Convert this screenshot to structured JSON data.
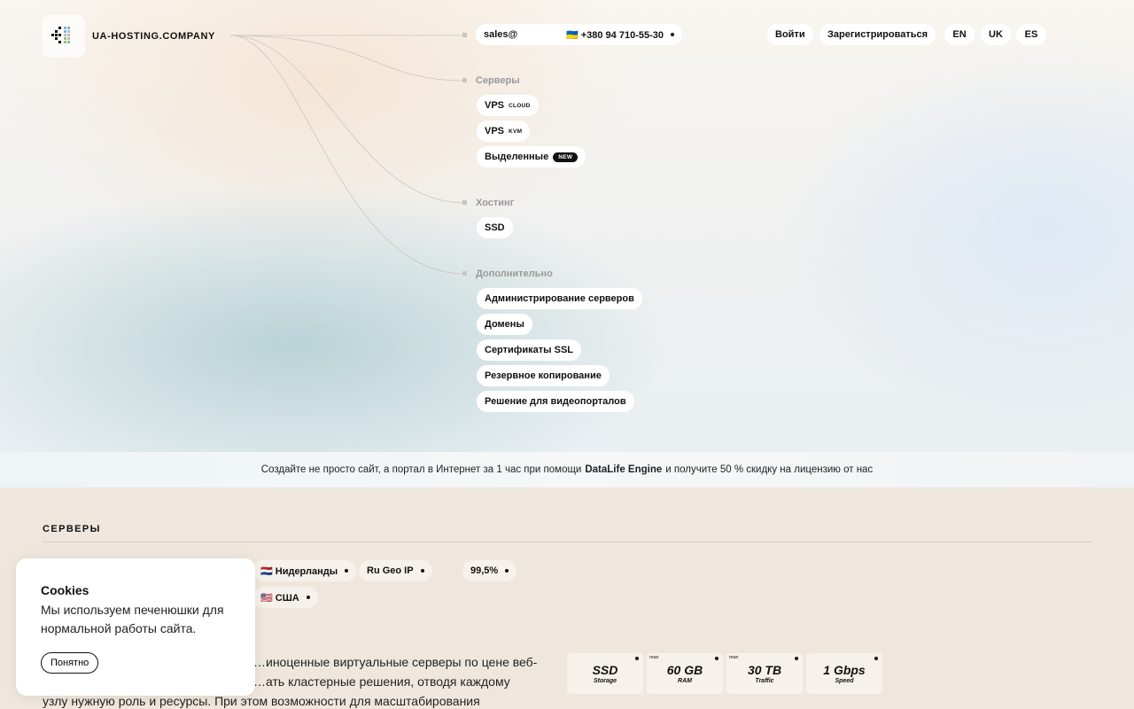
{
  "brand": {
    "name": "UA-HOSTING.COMPANY"
  },
  "contact": {
    "email": "sales@",
    "phone": "🇺🇦 +380 94 710-55-30"
  },
  "auth": {
    "login": "Войти",
    "register": "Зарегистрироваться"
  },
  "languages": [
    "EN",
    "UK",
    "ES"
  ],
  "menu": {
    "servers": {
      "title": "Серверы",
      "items": [
        {
          "label": "VPS",
          "tag": "CLOUD"
        },
        {
          "label": "VPS",
          "tag": "KVM"
        },
        {
          "label": "Выделенные",
          "badge": "NEW"
        }
      ]
    },
    "hosting": {
      "title": "Хостинг",
      "items": [
        {
          "label": "SSD"
        }
      ]
    },
    "extra": {
      "title": "Дополнительно",
      "items": [
        {
          "label": "Администрирование серверов"
        },
        {
          "label": "Домены"
        },
        {
          "label": "Сертификаты SSL"
        },
        {
          "label": "Резервное копирование"
        },
        {
          "label": "Решение для видеопорталов"
        }
      ]
    }
  },
  "promo": {
    "before": "Создайте не просто сайт, а портал в Интернет за 1 час при помощи",
    "highlight": "DataLife Engine",
    "after": "и получите 50 % скидку на лицензию от нас"
  },
  "section": {
    "title": "СЕРВЕРЫ",
    "locations": [
      "🇳🇱 Нидерланды",
      "Ru Geo IP",
      "🇺🇸 США"
    ],
    "uptime": "99,5%",
    "description_lines": [
      "…иноценные виртуальные серверы по цене веб-",
      "…ать кластерные решения, отводя каждому",
      "узлу нужную роль и ресурсы. При этом возможности для масштабирования"
    ],
    "specs": [
      {
        "value": "SSD",
        "label": "Storage",
        "max": ""
      },
      {
        "value": "60 GB",
        "label": "RAM",
        "max": "max"
      },
      {
        "value": "30 TB",
        "label": "Traffic",
        "max": "max"
      },
      {
        "value": "1 Gbps",
        "label": "Speed",
        "max": ""
      }
    ]
  },
  "cookie": {
    "title": "Cookies",
    "text": "Мы используем печенюшки для нормальной работы сайта.",
    "button": "Понятно"
  }
}
